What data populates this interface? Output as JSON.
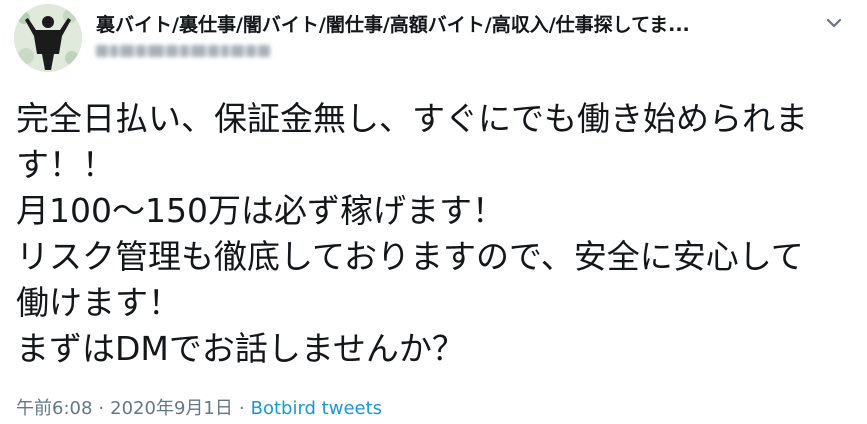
{
  "author": {
    "display_name": "裏バイト/裏仕事/闇バイト/闇仕事/高額バイト/高収入/仕事探してま...",
    "avatar_icon": "silhouette-avatar-icon",
    "handle_blurred": true
  },
  "tweet": {
    "lines": [
      "完全日払い、保証金無し、すぐにでも働き始められま",
      "す！！",
      "月100〜150万は必ず稼げます！",
      "リスク管理も徹底しておりますので、安全に安心して",
      "働けます！",
      "まずはDMでお話しませんか？"
    ]
  },
  "footer": {
    "time": "午前6:08",
    "separator": "·",
    "date": "2020年9月1日",
    "source": "Botbird tweets"
  },
  "icons": {
    "menu": "chevron-down-icon"
  },
  "colors": {
    "text": "#14171a",
    "muted": "#657786",
    "link": "#1b95e0"
  }
}
